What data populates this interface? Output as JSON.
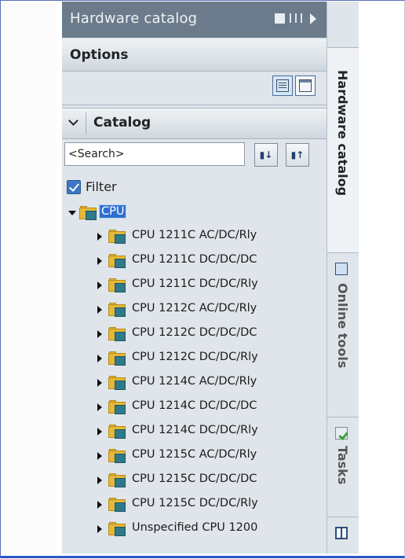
{
  "panel": {
    "title": "Hardware catalog",
    "title_icons": [
      "float-window-icon",
      "split-view-icon",
      "collapse-arrow-icon"
    ]
  },
  "options": {
    "label": "Options"
  },
  "catalog": {
    "label": "Catalog",
    "search_value": "<Search>",
    "search_buttons": [
      "search-down-icon",
      "search-up-icon"
    ],
    "filter_label": "Filter",
    "filter_checked": true
  },
  "tree": {
    "root": "CPU",
    "items": [
      "CPU 1211C AC/DC/Rly",
      "CPU 1211C DC/DC/DC",
      "CPU 1211C DC/DC/Rly",
      "CPU 1212C AC/DC/Rly",
      "CPU 1212C DC/DC/DC",
      "CPU 1212C DC/DC/Rly",
      "CPU 1214C AC/DC/Rly",
      "CPU 1214C DC/DC/DC",
      "CPU 1214C DC/DC/Rly",
      "CPU 1215C AC/DC/Rly",
      "CPU 1215C DC/DC/DC",
      "CPU 1215C DC/DC/Rly",
      "Unspecified CPU 1200"
    ]
  },
  "side_tabs": {
    "hardware_catalog": "Hardware catalog",
    "online_tools": "Online tools",
    "tasks": "Tasks"
  },
  "colors": {
    "title_bar": "#6c7b8b",
    "panel_bg": "#dfe5ea",
    "selection": "#2f6fd0",
    "folder": "#e4b838"
  }
}
